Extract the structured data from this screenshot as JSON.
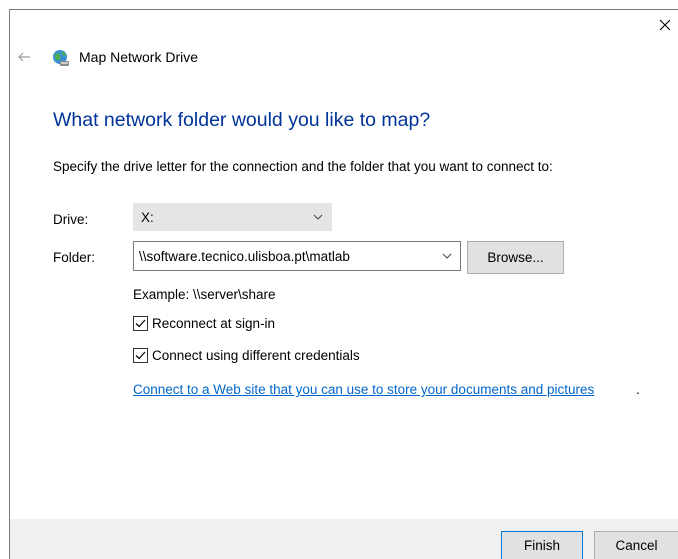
{
  "window": {
    "title": "Map Network Drive",
    "close_icon": "close-icon",
    "back_icon": "back-arrow-icon",
    "app_icon": "network-drive-icon"
  },
  "main": {
    "heading": "What network folder would you like to map?",
    "description": "Specify the drive letter for the connection and the folder that you want to connect to:",
    "drive_label": "Drive:",
    "drive_value": "X:",
    "folder_label": "Folder:",
    "folder_value": "\\\\software.tecnico.ulisboa.pt\\matlab",
    "browse_label": "Browse...",
    "example": "Example: \\\\server\\share",
    "reconnect_label": "Reconnect at sign-in",
    "reconnect_checked": true,
    "credentials_label": "Connect using different credentials",
    "credentials_checked": true,
    "web_link": "Connect to a Web site that you can use to store your documents and pictures",
    "web_link_suffix": "."
  },
  "footer": {
    "finish_label": "Finish",
    "cancel_label": "Cancel"
  },
  "colors": {
    "heading": "#003399",
    "link": "#0066cc",
    "footer_bg": "#f0f0f0",
    "button_bg": "#e1e1e1",
    "default_button_border": "#0078d7"
  }
}
